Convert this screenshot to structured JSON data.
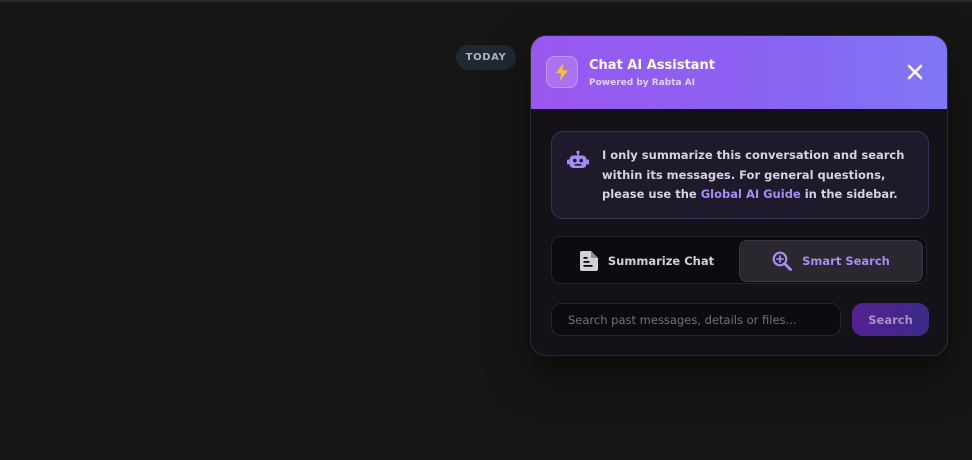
{
  "chat": {
    "date_divider": "TODAY"
  },
  "assistant": {
    "title": "Chat AI Assistant",
    "subtitle": "Powered by Rabta AI",
    "header_icon": "bolt-icon",
    "info": {
      "icon": "robot-icon",
      "text_before": "I only summarize this conversation and search within its messages. For general questions, please use the ",
      "link_text": "Global AI Guide",
      "text_after": " in the sidebar."
    },
    "tabs": [
      {
        "label": "Summarize Chat",
        "icon": "document-icon",
        "active": false
      },
      {
        "label": "Smart Search",
        "icon": "search-zoom-icon",
        "active": true
      }
    ],
    "search": {
      "placeholder": "Search past messages, details or files...",
      "value": "",
      "button_label": "Search"
    }
  },
  "colors": {
    "background": "#161616",
    "accent": "#9a57ee",
    "accent_light": "#a98bf5",
    "bolt": "#f6c12e"
  }
}
